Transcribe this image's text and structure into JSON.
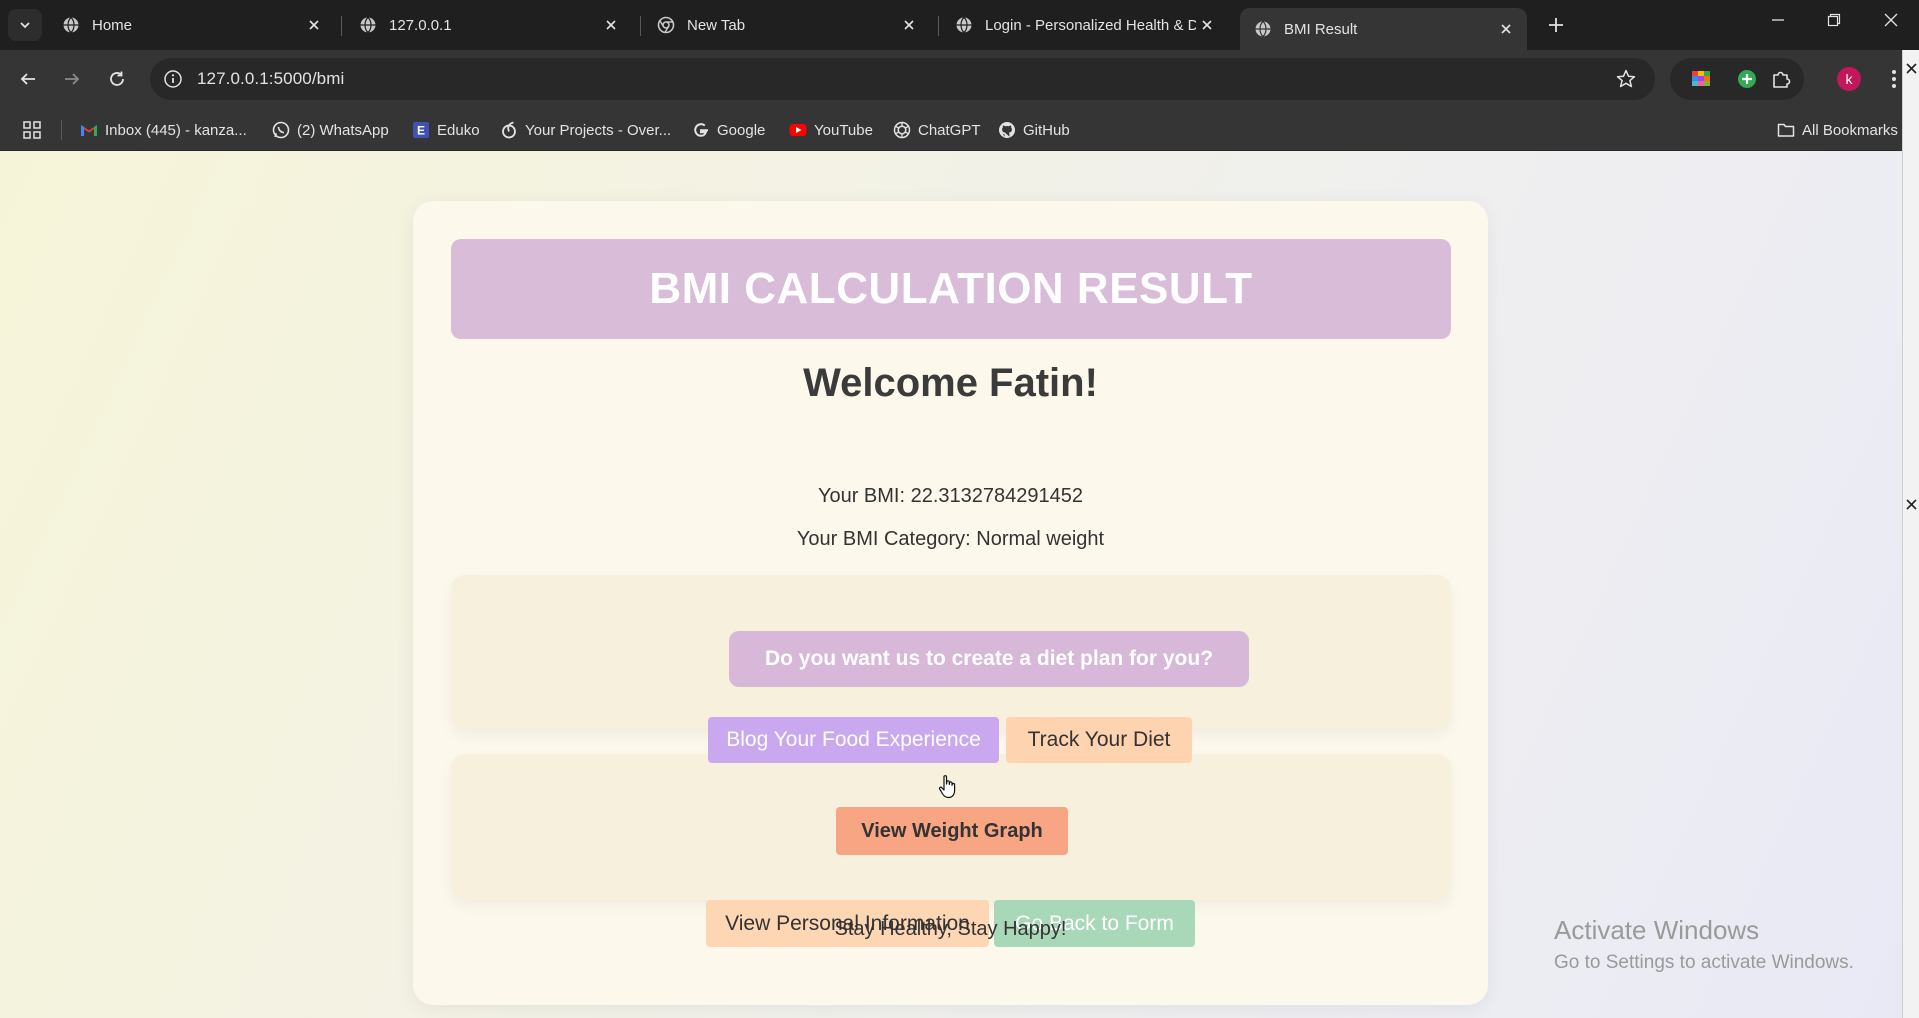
{
  "tabs": [
    {
      "title": "Home",
      "active": false
    },
    {
      "title": "127.0.0.1",
      "active": false
    },
    {
      "title": "New Tab",
      "active": false
    },
    {
      "title": "Login - Personalized Health & D",
      "active": false
    },
    {
      "title": "BMI Result",
      "active": true
    }
  ],
  "toolbar": {
    "url": "127.0.0.1:5000/bmi",
    "avatar_letter": "k"
  },
  "bookmarks": [
    {
      "label": "Inbox (445) - kanza...",
      "icon": "gmail-icon"
    },
    {
      "label": "(2) WhatsApp",
      "icon": "whatsapp-icon"
    },
    {
      "label": "Eduko",
      "icon": "eduko-icon"
    },
    {
      "label": "Your Projects - Over...",
      "icon": "overleaf-icon"
    },
    {
      "label": "Google",
      "icon": "google-icon"
    },
    {
      "label": "YouTube",
      "icon": "youtube-icon"
    },
    {
      "label": "ChatGPT",
      "icon": "chatgpt-icon"
    },
    {
      "label": "GitHub",
      "icon": "github-icon"
    }
  ],
  "bookmarks_folder": "All Bookmarks",
  "page": {
    "banner_title": "BMI CALCULATION RESULT",
    "welcome": "Welcome Fatin!",
    "bmi_line": "Your BMI: 22.3132784291452",
    "category_line": "Your BMI Category: Normal weight",
    "diet_button": "Do you want us to create a diet plan for you?",
    "blog_button": "Blog Your Food Experience",
    "track_button": "Track Your Diet",
    "graph_button": "View Weight Graph",
    "info_button": "View Personal Information",
    "back_button": "Go Back to Form",
    "tagline": "Stay Healthy, Stay Happy!"
  },
  "watermark": {
    "line1": "Activate Windows",
    "line2": "Go to Settings to activate Windows."
  },
  "colors": {
    "banner": "#d8bcd8",
    "diet_button": "#d8b8d8",
    "blog_button": "#caa8f0",
    "track_button": "#fdd3b0",
    "graph_button": "#f8a584",
    "info_button": "#fdd6b4",
    "back_button": "#a8d8b8"
  }
}
